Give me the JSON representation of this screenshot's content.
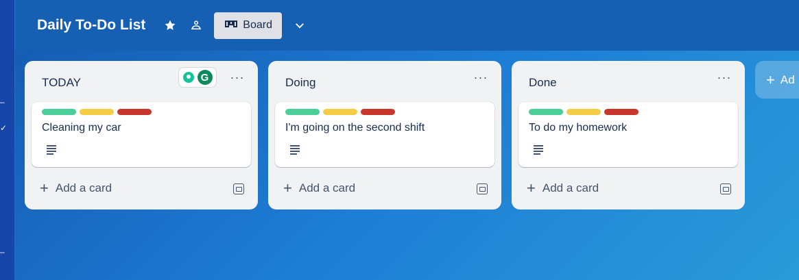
{
  "board": {
    "title": "Daily To-Do List",
    "view_label": "Board"
  },
  "colors": {
    "green": "#4bce97",
    "yellow": "#f5cd47",
    "red": "#c9372c"
  },
  "lists": [
    {
      "title": "TODAY",
      "card": {
        "text": "Cleaning my car"
      },
      "add_card_label": "Add a card"
    },
    {
      "title": "Doing",
      "card": {
        "text": "I'm going on the second shift"
      },
      "add_card_label": "Add a card"
    },
    {
      "title": "Done",
      "card": {
        "text": "To do my homework"
      },
      "add_card_label": "Add a card"
    }
  ],
  "add_list_label": "Ad",
  "grammarly": {
    "logo_letter": "G"
  }
}
